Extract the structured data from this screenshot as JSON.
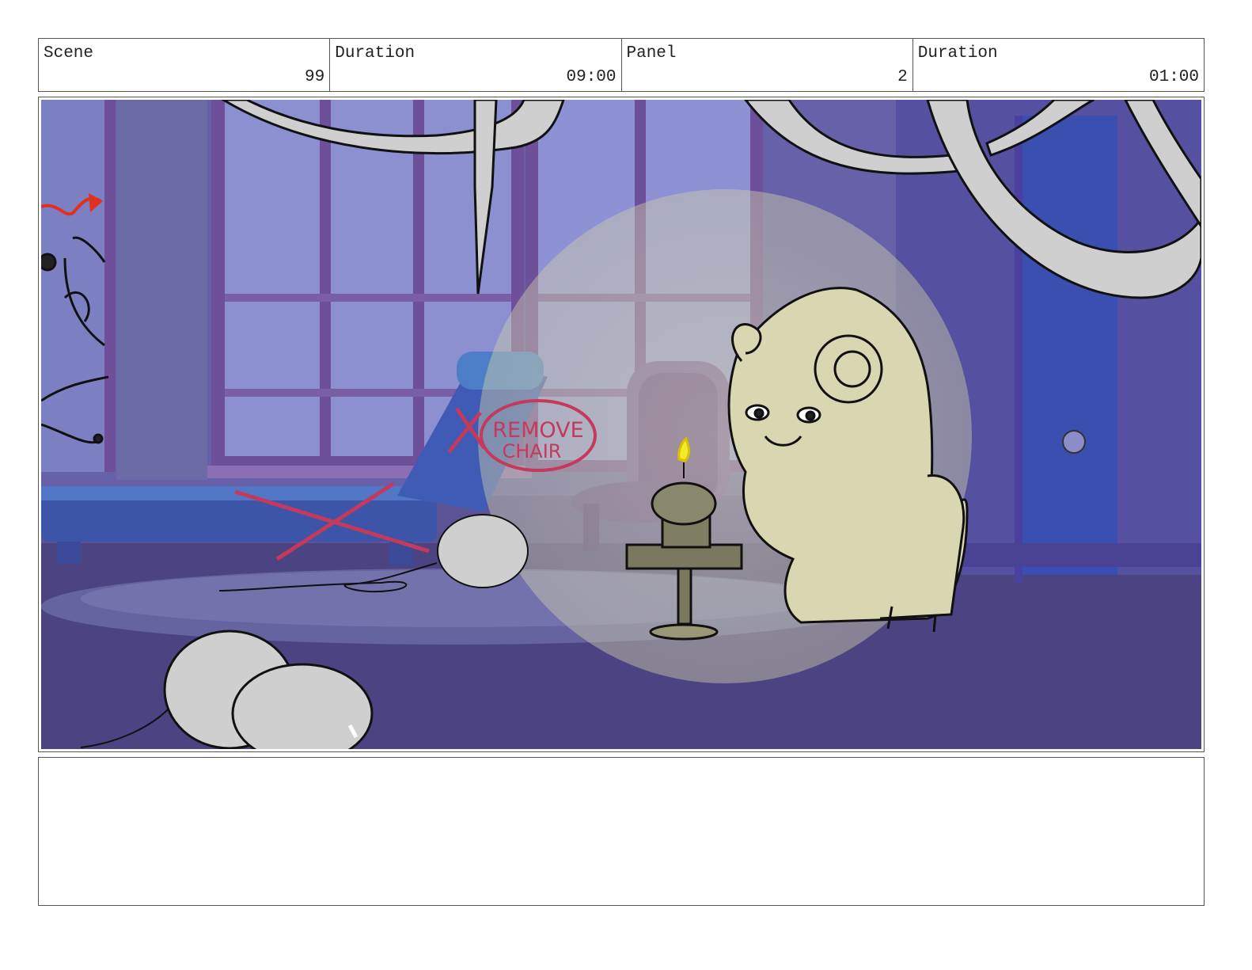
{
  "header": {
    "scene": {
      "label": "Scene",
      "value": "99"
    },
    "scene_duration": {
      "label": "Duration",
      "value": "09:00"
    },
    "panel": {
      "label": "Panel",
      "value": "2"
    },
    "panel_duration": {
      "label": "Duration",
      "value": "01:00"
    }
  },
  "panel_image": {
    "annotation_line1": "REMOVE",
    "annotation_line2": "CHAIR",
    "colors": {
      "room": "#5a5396",
      "floor": "#4c4482",
      "window_glass": "#8c8fd0",
      "window_frame": "#6e4f9a",
      "sofa": "#3d55a8",
      "door": "#3a4fb0",
      "markup_red": "#c33a5c",
      "arrow_red": "#e2301e",
      "spotlight": "#d8d7b0",
      "character": "#d9d6b2",
      "candle_flame": "#f3ea2a",
      "balloon": "#cfcfcf"
    }
  },
  "notes": {
    "text": ""
  }
}
